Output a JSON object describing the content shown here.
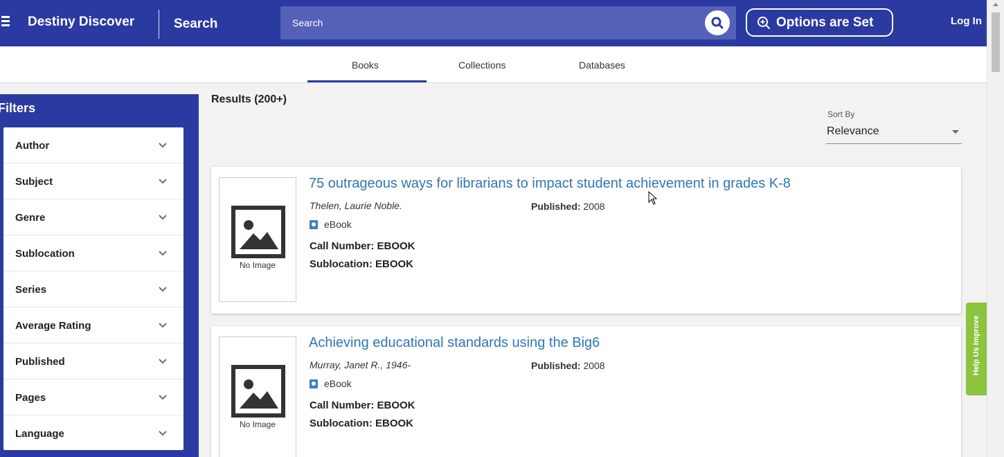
{
  "header": {
    "app_title": "Destiny Discover",
    "nav_label": "Search",
    "search_placeholder": "Search",
    "options_label": "Options are Set",
    "login_label": "Log In"
  },
  "tabs": [
    {
      "label": "Books",
      "active": true
    },
    {
      "label": "Collections",
      "active": false
    },
    {
      "label": "Databases",
      "active": false
    }
  ],
  "filters": {
    "title": "Filters",
    "items": [
      {
        "label": "Author"
      },
      {
        "label": "Subject"
      },
      {
        "label": "Genre"
      },
      {
        "label": "Sublocation"
      },
      {
        "label": "Series"
      },
      {
        "label": "Average Rating"
      },
      {
        "label": "Published"
      },
      {
        "label": "Pages"
      },
      {
        "label": "Language"
      }
    ]
  },
  "results": {
    "count_label": "Results (200+)",
    "sort_label": "Sort By",
    "sort_value": "Relevance",
    "items": [
      {
        "title": "75 outrageous ways for librarians to impact student achievement in grades K-8",
        "author": "Thelen, Laurie Noble.",
        "published_label": "Published:",
        "published_year": "2008",
        "format": "eBook",
        "call_number": "Call Number: EBOOK",
        "sublocation": "Sublocation: EBOOK",
        "no_image_label": "No Image"
      },
      {
        "title": "Achieving educational standards using the Big6",
        "author": "Murray, Janet R., 1946-",
        "published_label": "Published:",
        "published_year": "2008",
        "format": "eBook",
        "call_number": "Call Number: EBOOK",
        "sublocation": "Sublocation: EBOOK",
        "no_image_label": "No Image"
      }
    ]
  },
  "help_tab": {
    "label": "Help Us Improve"
  },
  "colors": {
    "header_bg": "#2b3aa0",
    "link_blue": "#2f76b6",
    "help_green": "#8cc43f"
  }
}
